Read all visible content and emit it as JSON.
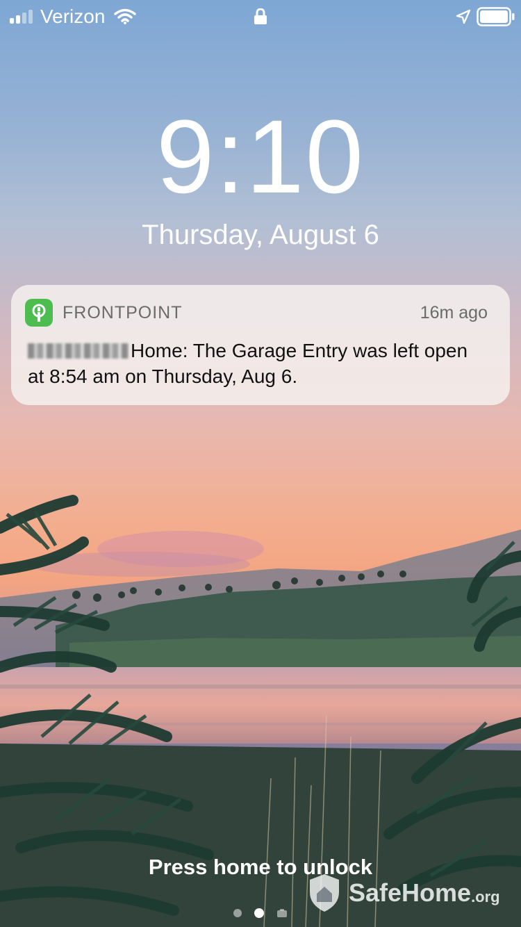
{
  "status_bar": {
    "carrier": "Verizon",
    "signal_bars_filled": 2,
    "signal_bars_total": 4,
    "icons": [
      "signal-icon",
      "wifi-icon",
      "lock-icon",
      "location-icon",
      "battery-icon"
    ]
  },
  "lock_screen": {
    "time": "9:10",
    "date": "Thursday, August 6",
    "unlock_hint": "Press home to unlock",
    "page_dots_total": 3,
    "page_dots_active": 1
  },
  "notification": {
    "app_name": "FRONTPOINT",
    "time_ago": "16m ago",
    "message": "Home: The Garage Entry was left open at 8:54 am on Thursday, Aug 6.",
    "icon": "frontpoint-app-icon",
    "icon_color": "#4cbd4e"
  },
  "watermark": {
    "brand": "SafeHome",
    "tld": ".org"
  }
}
